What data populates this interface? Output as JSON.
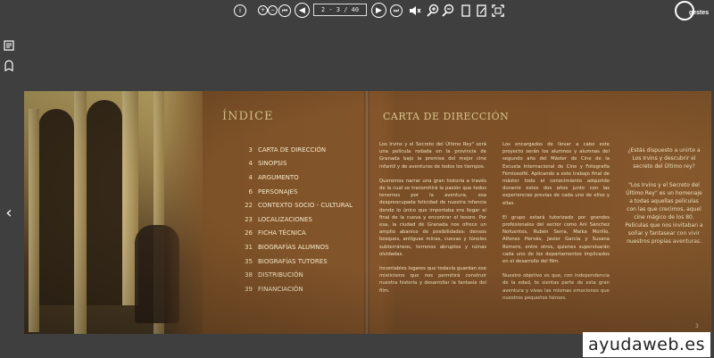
{
  "toolbar": {
    "info_icon": "info-icon",
    "pager_value": "2 - 3 / 40",
    "logo_text": "gestes"
  },
  "index_page": {
    "title": "ÍNDICE",
    "items": [
      {
        "num": "3",
        "label": "CARTA DE DIRECCIÓN"
      },
      {
        "num": "4",
        "label": "SINOPSIS"
      },
      {
        "num": "4",
        "label": "ARGUMENTO"
      },
      {
        "num": "6",
        "label": "PERSONAJES"
      },
      {
        "num": "22",
        "label": "CONTEXTO SOCIO - CULTURAL"
      },
      {
        "num": "23",
        "label": "LOCALIZACIONES"
      },
      {
        "num": "26",
        "label": "FICHA TÉCNICA"
      },
      {
        "num": "31",
        "label": "BIOGRAFÍAS ALUMNOS"
      },
      {
        "num": "35",
        "label": "BIOGRAFÍAS TUTORES"
      },
      {
        "num": "38",
        "label": "DISTRIBUCIÓN"
      },
      {
        "num": "39",
        "label": "FINANCIACIÓN"
      }
    ]
  },
  "letter_page": {
    "title": "CARTA DE DIRECCIÓN",
    "col1": [
      "Los Irvins y el Secreto del Último Rey\" será una película rodada en la provincia de Granada bajo la premisa del mejor cine infantil y de aventuras de todos los tiempos.",
      "Queremos narrar una gran historia a través de la cual se transmitirá la pasión que todos tenemos por la aventura, esa despreocupada felicidad de nuestra infancia donde lo único que importaba era llegar al final de la cueva y encontrar el tesoro. Por esa, la ciudad de Granada nos ofrece un amplio abanico de posibilidades: densos bosques, antiguas minas, cuevas y túneles subterráneos, terrenos abruptos y ruinas olvidadas.",
      "Incontables lugares que todavía guardan ese misticismo que nos permitirá construir nuestra historia y desarrollar la fantasía del film."
    ],
    "col2": [
      "Los encargados de llevar a cabo este proyecto serán los alumnos y alumnas del segundo año del Máster de Cine de la Escuela Internacional de Cine y Fotografía Fémiosolfé. Aplicando a este trabajo final de máster todo el conocimiento adquirido durante estos dos años junto con las experiencias previas de cada uno de ellos y ellas.",
      "El grupo estará tutorizado por grandes profesionales del sector como Ani Sánchez Nofuentes, Rubén Serra, Maika Morillo, Alfonso Hervás, Javier García y Susana Romero, entre otros, quienes supervisarán cada uno de los departamentos implicados en el desarrollo del film.",
      "Nuestro objetivo es que, con independencia de la edad, te sientas parte de esta gran aventura y vivas las mismas emociones que nuestros pequeños héroes."
    ],
    "col3": [
      "¿Estás dispuesto a unirte a Los Irvins y descubrir el secreto del Último rey?",
      "\"Los Irvins y el Secreto del Último Rey\" es un homenaje a todas aquellas películas con las que crecimos, aquel cine mágico de los 80. Películas que nos invitaban a soñar y fantasear con vivir nuestros propias aventuras."
    ],
    "page_number": "3"
  },
  "watermark": "ayudaweb.es"
}
